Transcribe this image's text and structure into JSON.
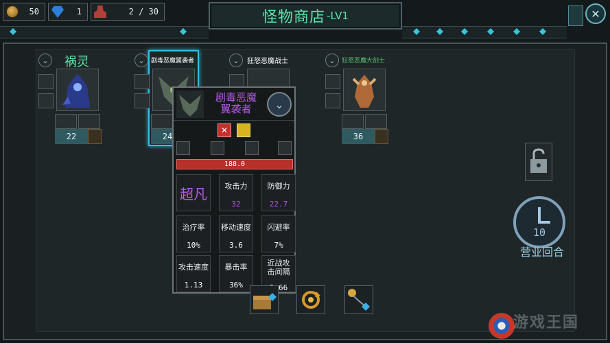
{
  "resources": {
    "coins": "50",
    "gems": "1",
    "population": "2 / 30"
  },
  "header": {
    "title": "怪物商店",
    "level": "-LV1"
  },
  "shop": {
    "slots": [
      {
        "name": "祸灵",
        "price": "22",
        "name_color": "#58e6a8"
      },
      {
        "name": "剧毒恶魔翼袭者",
        "price": "24",
        "name_color": "#ffffff"
      },
      {
        "name": "狂怒恶魔战士",
        "price": "",
        "name_color": "#ffffff"
      },
      {
        "name": "狂怒恶魔大剑士",
        "price": "36",
        "name_color": "#58c070"
      }
    ]
  },
  "detail": {
    "name": "剧毒恶魔翼袭者",
    "name_line1": "剧毒恶魔",
    "name_line2": "翼袭者",
    "hp": "188.0",
    "rarity": "超凡",
    "stats": [
      {
        "label": "攻击力",
        "value": "32",
        "highlight": true
      },
      {
        "label": "防御力",
        "value": "22.7",
        "highlight": true
      },
      {
        "label": "治疗率",
        "value": "10%"
      },
      {
        "label": "移动速度",
        "value": "3.6"
      },
      {
        "label": "闪避率",
        "value": "7%"
      },
      {
        "label": "攻击速度",
        "value": "1.13"
      },
      {
        "label": "暴击率",
        "value": "36%"
      },
      {
        "label_line1": "近战攻",
        "label_line2": "击间隔",
        "value": "2.66"
      }
    ]
  },
  "round": {
    "count": "10",
    "label": "营业回合"
  },
  "watermark": "游戏王国",
  "colors": {
    "accent_green": "#58e6a8",
    "rarity_purple": "#b45ae6",
    "selected_cyan": "#2fc2e4",
    "hp_red": "#b8302a"
  }
}
